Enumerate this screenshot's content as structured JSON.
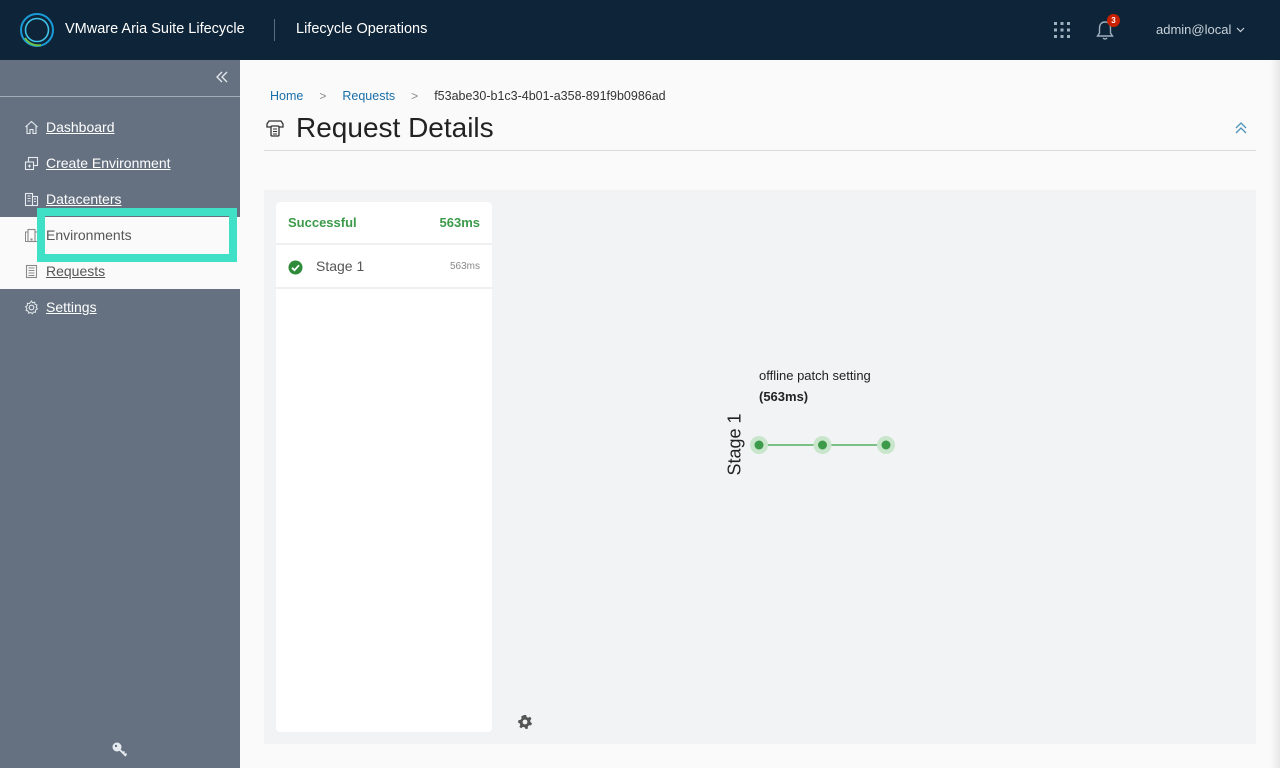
{
  "header": {
    "app_title": "VMware Aria Suite Lifecycle",
    "app_subtitle": "Lifecycle Operations",
    "notification_count": "3",
    "user": "admin@local"
  },
  "sidebar": {
    "items": [
      {
        "label": "Dashboard",
        "icon": "home-icon"
      },
      {
        "label": "Create Environment",
        "icon": "create-environment-icon"
      },
      {
        "label": "Datacenters",
        "icon": "datacenter-icon"
      },
      {
        "label": "Environments",
        "icon": "environments-icon"
      },
      {
        "label": "Requests",
        "icon": "requests-icon"
      },
      {
        "label": "Settings",
        "icon": "settings-icon"
      }
    ]
  },
  "breadcrumb": {
    "home": "Home",
    "requests": "Requests",
    "current": "f53abe30-b1c3-4b01-a358-891f9b0986ad"
  },
  "page": {
    "title": "Request Details"
  },
  "stages_panel": {
    "status": "Successful",
    "total_duration": "563ms",
    "stages": [
      {
        "name": "Stage 1",
        "duration": "563ms",
        "status": "success"
      }
    ]
  },
  "flow": {
    "stage_label": "Stage 1",
    "task_label": "offline patch setting",
    "task_duration": "(563ms)",
    "nodes": 3,
    "color": "#3c9a4a"
  },
  "colors": {
    "header_bg": "#0e2438",
    "sidebar_bg": "#657180",
    "success": "#3c9a4a",
    "highlight": "#3fe0c5",
    "link": "#1b6fa8"
  }
}
